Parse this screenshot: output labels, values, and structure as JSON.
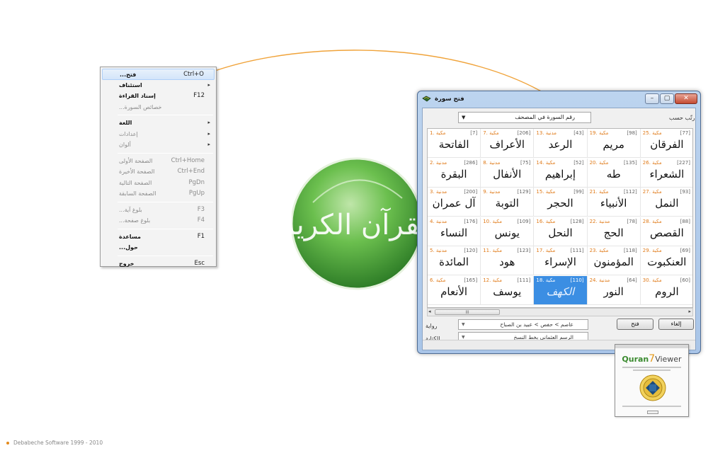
{
  "menu": {
    "items": [
      {
        "label": "فتح...",
        "shortcut": "Ctrl+O",
        "highlight": true
      },
      {
        "label": "استئناف",
        "submenu": true
      },
      {
        "label": "إسناد القراءة",
        "shortcut": "F12"
      },
      {
        "label": "خصائص السورة...",
        "disabled": true
      },
      {
        "label": "اللغة",
        "submenu": true
      },
      {
        "label": "إعدادات",
        "submenu": true,
        "disabled": true
      },
      {
        "label": "ألوان",
        "submenu": true,
        "disabled": true
      },
      {
        "label": "الصفحة الأولى",
        "shortcut": "Ctrl+Home",
        "disabled": true
      },
      {
        "label": "الصفحة الأخيرة",
        "shortcut": "Ctrl+End",
        "disabled": true
      },
      {
        "label": "الصفحة التالية",
        "shortcut": "PgDn",
        "disabled": true
      },
      {
        "label": "الصفحة السابقة",
        "shortcut": "PgUp",
        "disabled": true
      },
      {
        "label": "بلوغ آية...",
        "shortcut": "F3",
        "disabled": true
      },
      {
        "label": "بلوغ صفحة...",
        "shortcut": "F4",
        "disabled": true
      },
      {
        "label": "مساعدة",
        "shortcut": "F1"
      },
      {
        "label": "حول..."
      },
      {
        "label": "خروج",
        "shortcut": "Esc"
      }
    ]
  },
  "dialog": {
    "title": "فتح سورة",
    "sort_label": "رتّب حسب",
    "sort_value": "رقم السورة في المصحف",
    "riwaya_label": "رواية",
    "riwaya_value": "عاصم > حفص > عبيد بن الصباح",
    "script_label": "الكتابة",
    "script_value": "الرسم العثماني بخط النسخ",
    "open_button": "فتح",
    "cancel_button": "إلغاء",
    "scroll_thumb": "III"
  },
  "surahs": [
    {
      "num": 1,
      "type": "مكية",
      "ayat": 7,
      "name": "الفاتحة"
    },
    {
      "num": 2,
      "type": "مدنية",
      "ayat": 286,
      "name": "البقرة"
    },
    {
      "num": 3,
      "type": "مدنية",
      "ayat": 200,
      "name": "آل عمران"
    },
    {
      "num": 4,
      "type": "مدنية",
      "ayat": 176,
      "name": "النساء"
    },
    {
      "num": 5,
      "type": "مدنية",
      "ayat": 120,
      "name": "المائدة"
    },
    {
      "num": 6,
      "type": "مكية",
      "ayat": 165,
      "name": "الأنعام"
    },
    {
      "num": 7,
      "type": "مكية",
      "ayat": 206,
      "name": "الأعراف"
    },
    {
      "num": 8,
      "type": "مدنية",
      "ayat": 75,
      "name": "الأنفال"
    },
    {
      "num": 9,
      "type": "مدنية",
      "ayat": 129,
      "name": "التوبة"
    },
    {
      "num": 10,
      "type": "مكية",
      "ayat": 109,
      "name": "يونس"
    },
    {
      "num": 11,
      "type": "مكية",
      "ayat": 123,
      "name": "هود"
    },
    {
      "num": 12,
      "type": "مكية",
      "ayat": 111,
      "name": "يوسف"
    },
    {
      "num": 13,
      "type": "مدنية",
      "ayat": 43,
      "name": "الرعد"
    },
    {
      "num": 14,
      "type": "مكية",
      "ayat": 52,
      "name": "إبراهيم"
    },
    {
      "num": 15,
      "type": "مكية",
      "ayat": 99,
      "name": "الحجر"
    },
    {
      "num": 16,
      "type": "مكية",
      "ayat": 128,
      "name": "النحل"
    },
    {
      "num": 17,
      "type": "مكية",
      "ayat": 111,
      "name": "الإسراء"
    },
    {
      "num": 18,
      "type": "مكية",
      "ayat": 110,
      "name": "الكهف",
      "selected": true
    },
    {
      "num": 19,
      "type": "مكية",
      "ayat": 98,
      "name": "مريم"
    },
    {
      "num": 20,
      "type": "مكية",
      "ayat": 135,
      "name": "طه"
    },
    {
      "num": 21,
      "type": "مكية",
      "ayat": 112,
      "name": "الأنبياء"
    },
    {
      "num": 22,
      "type": "مدنية",
      "ayat": 78,
      "name": "الحج"
    },
    {
      "num": 23,
      "type": "مكية",
      "ayat": 118,
      "name": "المؤمنون"
    },
    {
      "num": 24,
      "type": "مدنية",
      "ayat": 64,
      "name": "النور"
    },
    {
      "num": 25,
      "type": "مكية",
      "ayat": 77,
      "name": "الفرقان"
    },
    {
      "num": 26,
      "type": "مكية",
      "ayat": 227,
      "name": "الشعراء"
    },
    {
      "num": 27,
      "type": "مكية",
      "ayat": 93,
      "name": "النمل"
    },
    {
      "num": 28,
      "type": "مكية",
      "ayat": 88,
      "name": "القصص"
    },
    {
      "num": 29,
      "type": "مكية",
      "ayat": 69,
      "name": "العنكبوت"
    },
    {
      "num": 30,
      "type": "مكية",
      "ayat": 60,
      "name": "الروم"
    }
  ],
  "logo": {
    "text": "القرآن الكريم",
    "color": "#3f9a3a"
  },
  "splash": {
    "brand": "Quran",
    "seven": "7",
    "viewer": "Viewer"
  },
  "footer": {
    "text": "Debabeche Software 1999 - 2010"
  },
  "colors": {
    "accent": "#e38a1c",
    "selection": "#3b8ee3"
  }
}
